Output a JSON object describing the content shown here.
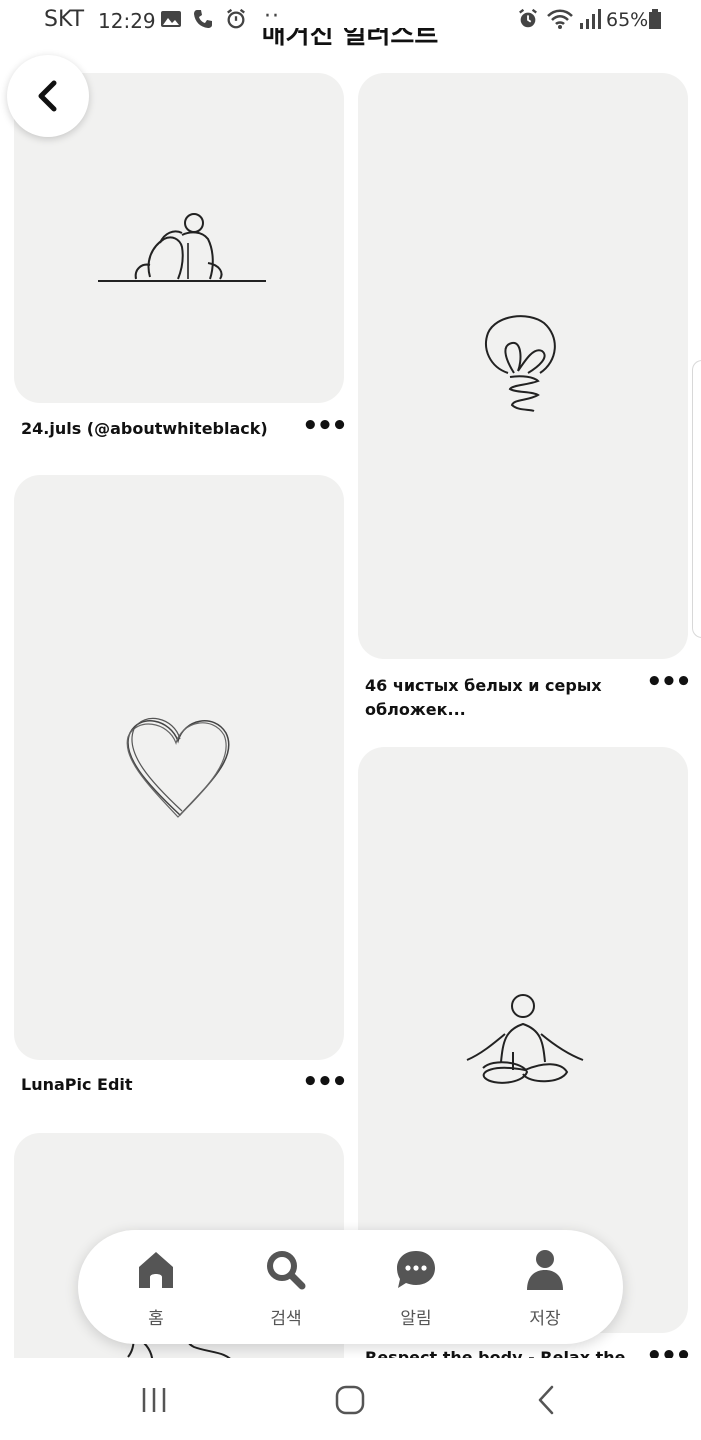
{
  "status_bar": {
    "carrier": "SKT",
    "time": "12:29",
    "dots": "··",
    "battery": "65%"
  },
  "board": {
    "title": "매거진 일러스트"
  },
  "pins": [
    {
      "title": "24.juls (@aboutwhiteblack)",
      "image_icon": "couple-sitting-line-art"
    },
    {
      "title": "LunaPic Edit",
      "image_icon": "heart-line-art"
    },
    {
      "title": "",
      "image_icon": "figures-line-art"
    },
    {
      "title": "46 чистых белых и серых обложек...",
      "image_icon": "lightbulb-line-art"
    },
    {
      "title": "Respect the body - Relax the ...",
      "image_icon": "meditation-figure-line-art"
    }
  ],
  "more_label": "•••",
  "bottom_nav": [
    {
      "label": "홈",
      "icon": "home-icon"
    },
    {
      "label": "검색",
      "icon": "search-icon"
    },
    {
      "label": "알림",
      "icon": "chat-bubble-icon"
    },
    {
      "label": "저장",
      "icon": "profile-icon"
    }
  ],
  "colors": {
    "pin_bg": "#f1f1f0",
    "nav_icon": "#555555",
    "text": "#111111"
  }
}
